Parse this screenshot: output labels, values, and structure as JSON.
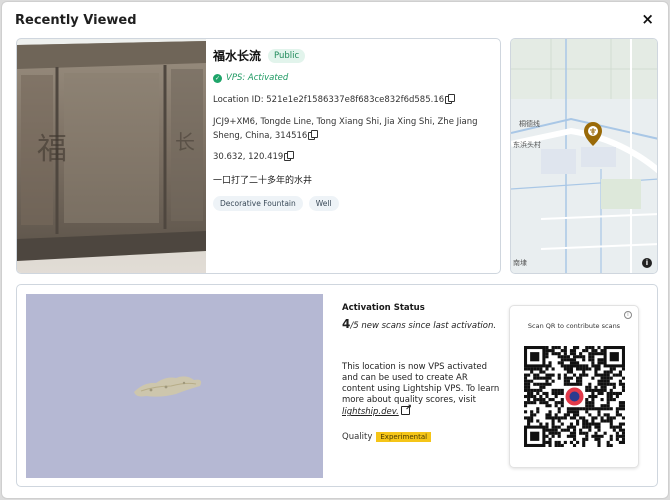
{
  "modal": {
    "title": "Recently Viewed",
    "close_label": "×"
  },
  "location": {
    "name": "福水长流",
    "visibility_badge": "Public",
    "vps_status": "VPS: Activated",
    "location_id_label": "Location ID: 521e1e2f1586337e8f683ce832f6d585.16",
    "address_line1": "JCJ9+XM6, Tongde Line, Tong Xiang Shi, Jia Xing Shi, Zhe Jiang",
    "address_line2": "Sheng, China, 314516",
    "coordinates": "30.632, 120.419",
    "description": "一口打了二十多年的水井",
    "tags": [
      "Decorative Fountain",
      "Well"
    ],
    "photo_carving": "福"
  },
  "map": {
    "labels": [
      "桐德线",
      "东浜头村",
      "南埭"
    ],
    "info_label": "i",
    "colors": {
      "background": "#e6ecee",
      "road": "#ffffff",
      "water": "#a9c7e6",
      "green": "#dce9d6",
      "pin": "#9a6a08"
    }
  },
  "activation": {
    "title": "Activation Status",
    "count_number": "4",
    "count_rest": "/5 new scans since last activation.",
    "body_text": "This location is now VPS activated and can be used to create AR content using Lightship VPS. To learn more about quality scores, visit",
    "link_text": "lightship.dev.",
    "quality_label": "Quality",
    "quality_badge": "Experimental"
  },
  "qr": {
    "caption": "Scan QR to contribute scans",
    "info_label": "i"
  }
}
